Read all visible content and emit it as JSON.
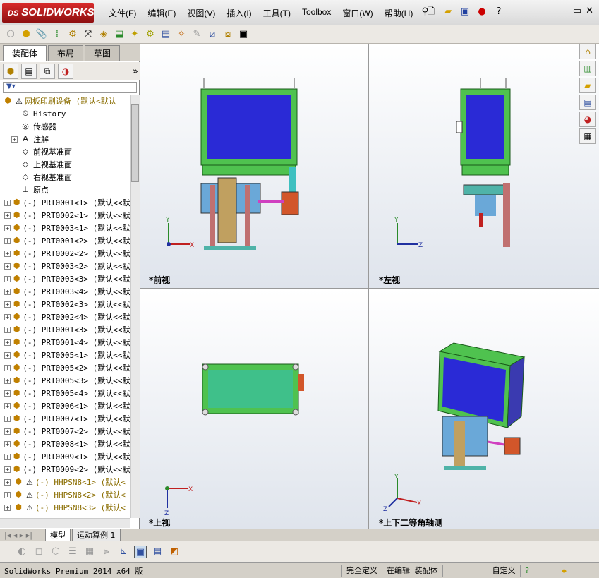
{
  "app": {
    "logo_prefix": "DS",
    "logo_text": "SOLIDWORKS"
  },
  "menu": [
    "文件(F)",
    "编辑(E)",
    "视图(V)",
    "插入(I)",
    "工具(T)",
    "Toolbox",
    "窗口(W)",
    "帮助(H)"
  ],
  "left_tabs": [
    "装配体",
    "布局",
    "草图"
  ],
  "tree": {
    "root": "网板印刷设备 (默认<默认",
    "items": [
      {
        "icon": "history-icon",
        "label": "History",
        "exp": false
      },
      {
        "icon": "sensor-icon",
        "label": "传感器",
        "exp": false
      },
      {
        "icon": "annotation-icon",
        "label": "注解",
        "exp": true
      },
      {
        "icon": "plane-icon",
        "label": "前视基准面",
        "exp": false
      },
      {
        "icon": "plane-icon",
        "label": "上视基准面",
        "exp": false
      },
      {
        "icon": "plane-icon",
        "label": "右视基准面",
        "exp": false
      },
      {
        "icon": "origin-icon",
        "label": "原点",
        "exp": false
      }
    ],
    "parts": [
      "(-) PRT0001<1> (默认<<默",
      "(-) PRT0002<1> (默认<<默",
      "(-) PRT0003<1> (默认<<默",
      "(-) PRT0001<2> (默认<<默",
      "(-) PRT0002<2> (默认<<默",
      "(-) PRT0003<2> (默认<<默",
      "(-) PRT0003<3> (默认<<默",
      "(-) PRT0003<4> (默认<<默",
      "(-) PRT0002<3> (默认<<默",
      "(-) PRT0002<4> (默认<<默",
      "(-) PRT0001<3> (默认<<默",
      "(-) PRT0001<4> (默认<<默",
      "(-) PRT0005<1> (默认<<默",
      "(-) PRT0005<2> (默认<<默",
      "(-) PRT0005<3> (默认<<默",
      "(-) PRT0005<4> (默认<<默",
      "(-) PRT0006<1> (默认<<默",
      "(-) PRT0007<1> (默认<<默",
      "(-) PRT0007<2> (默认<<默",
      "(-) PRT0008<1> (默认<<默",
      "(-) PRT0009<1> (默认<<默",
      "(-) PRT0009<2> (默认<<默"
    ],
    "warn_parts": [
      "(-) HHPSN8<1> (默认<",
      "(-) HHPSN8<2> (默认<",
      "(-) HHPSN8<3> (默认<"
    ]
  },
  "views": {
    "front": "*前视",
    "left": "*左视",
    "top": "*上视",
    "iso": "*上下二等角轴测"
  },
  "bottom_tabs": [
    "模型",
    "运动算例 1"
  ],
  "status": {
    "product": "SolidWorks Premium 2014 x64 版",
    "defined": "完全定义",
    "editing": "在编辑 装配体",
    "custom": "自定义"
  },
  "colors": {
    "frame": "#4fc24f",
    "panel": "#2a2ad6",
    "base": "#4fb3a8",
    "motor": "#d2562a",
    "accent": "#c02020"
  }
}
